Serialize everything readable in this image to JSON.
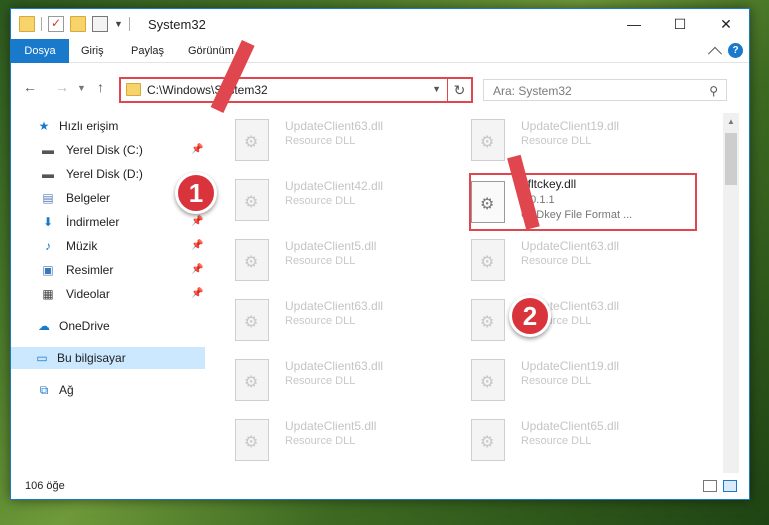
{
  "window": {
    "title": "System32"
  },
  "ribbon": {
    "tabs": [
      "Dosya",
      "Giriş",
      "Paylaş",
      "Görünüm"
    ]
  },
  "nav": {
    "address": "C:\\Windows\\System32",
    "search_placeholder": "Ara: System32"
  },
  "sidebar": {
    "quick_access": "Hızlı erişim",
    "items": [
      {
        "label": "Yerel Disk (C:)",
        "pinned": true
      },
      {
        "label": "Yerel Disk (D:)",
        "pinned": false
      },
      {
        "label": "Belgeler",
        "pinned": true
      },
      {
        "label": "İndirmeler",
        "pinned": true
      },
      {
        "label": "Müzik",
        "pinned": true
      },
      {
        "label": "Resimler",
        "pinned": true
      },
      {
        "label": "Videolar",
        "pinned": true
      }
    ],
    "onedrive": "OneDrive",
    "this_pc": "Bu bilgisayar",
    "network": "Ağ"
  },
  "files": {
    "left": [
      {
        "name": "UpdateClient63.dll",
        "desc": "Resource DLL"
      },
      {
        "name": "UpdateClient42.dll",
        "desc": "Resource DLL"
      },
      {
        "name": "UpdateClient5.dll",
        "desc": "Resource DLL"
      },
      {
        "name": "UpdateClient63.dll",
        "desc": "Resource DLL"
      },
      {
        "name": "UpdateClient63.dll",
        "desc": "Resource DLL"
      },
      {
        "name": "UpdateClient5.dll",
        "desc": "Resource DLL"
      }
    ],
    "right": [
      {
        "name": "UpdateClient19.dll",
        "desc": "Resource DLL"
      },
      {
        "name": "UpdateClient63.dll",
        "desc": "Resource DLL"
      },
      {
        "name": "UpdateClient63.dll",
        "desc": "Resource DLL"
      },
      {
        "name": "UpdateClient19.dll",
        "desc": "Resource DLL"
      },
      {
        "name": "UpdateClient65.dll",
        "desc": "Resource DLL"
      }
    ],
    "highlighted": {
      "name": "pfltckey.dll",
      "version": "2.0.1.1",
      "desc": "CADkey File Format ..."
    }
  },
  "status": {
    "count": "106 öğe"
  },
  "annotations": {
    "step1": "1",
    "step2": "2"
  },
  "colors": {
    "accent": "#1979ca",
    "highlight": "#e0464e"
  }
}
